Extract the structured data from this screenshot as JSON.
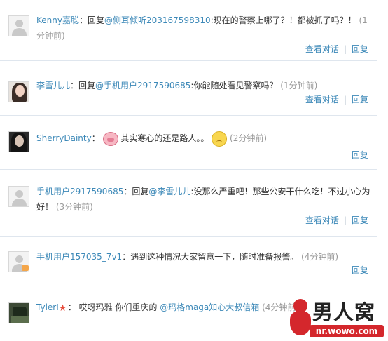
{
  "actions": {
    "view_conversation": "查看对话",
    "separator": "|",
    "reply": "回复"
  },
  "comments": [
    {
      "user": "Kenny嘉聪",
      "colon": "：",
      "reply_prefix": "回复",
      "mention": "@侧耳倾听203167598310",
      "text": ":现在的警察上哪了？！都被抓了吗？！",
      "time": "(1分钟前)",
      "avatar": "default-avatar"
    },
    {
      "user": "李雪儿儿",
      "colon": "：",
      "reply_prefix": "回复",
      "mention": "@手机用户2917590685",
      "text": ":你能随处看见警察吗？",
      "time": "(1分钟前)",
      "avatar": "girl-photo-avatar"
    },
    {
      "user": "SherryDainty",
      "colon": "：",
      "text_before_emoji": "其实寒心的还是路人。。",
      "time": "(2分钟前)",
      "avatar": "woman-dark-avatar",
      "emoji_1": "pig-emoticon",
      "emoji_2": "sad-face-emoticon"
    },
    {
      "user": "手机用户2917590685",
      "colon": "：",
      "reply_prefix": "回复",
      "mention": "@李雪儿儿",
      "text": ":没那么严重吧！那些公安干什么吃！不过小心为好！",
      "time": "(3分钟前)",
      "avatar": "default-avatar"
    },
    {
      "user": "手机用户157035_7v1",
      "colon": "：",
      "text": "遇到这种情况大家留意一下，随时准备报警。",
      "time": "(4分钟前)",
      "avatar": "default-avatar-with-badge"
    },
    {
      "user": "TylerI",
      "colon": "：",
      "text": "哎呀玛雅 你们重庆的",
      "mention": "@玛格maga知心大叔信箱",
      "time": "(4分钟前)",
      "avatar": "dark-scenery-avatar",
      "badge": "star-badge"
    }
  ],
  "watermark": {
    "logo": "男人窝",
    "url": "nr.wowo.com"
  },
  "colors": {
    "link": "#3d89b8",
    "text": "#333333",
    "muted": "#999999",
    "divider": "#dfe6ee",
    "brand_red": "#d4272c"
  }
}
